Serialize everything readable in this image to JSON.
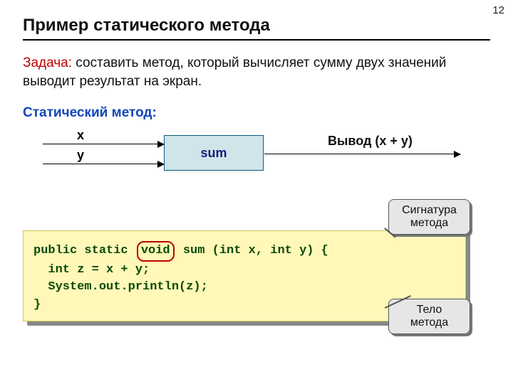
{
  "page_number": "12",
  "title": "Пример статического метода",
  "task": {
    "label": "Задача:",
    "text": " составить метод, который вычисляет сумму двух значений выводит результат на экран."
  },
  "static_method_label": "Статический метод:",
  "diagram": {
    "input_x": "x",
    "input_y": "y",
    "box_label": "sum",
    "output_label": "Вывод (x + y)"
  },
  "code": {
    "line1_pre": "public static ",
    "void_token": "void",
    "line1_post": " sum (int x, int y) {",
    "line2": "  int z = x + y;",
    "line3": "  System.out.println(z);",
    "line4": "}"
  },
  "callouts": {
    "signature": "Сигнатура метода",
    "body": "Тело метода"
  }
}
